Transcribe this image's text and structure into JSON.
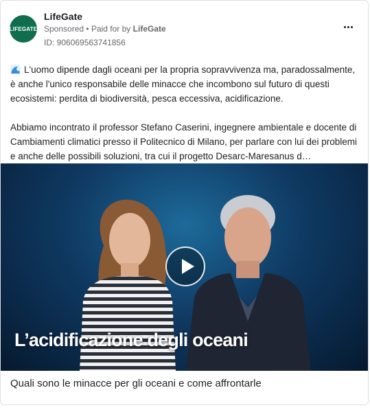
{
  "page": {
    "name": "LifeGate",
    "avatar_text": "LIFEGATE",
    "sponsored_label": "Sponsored",
    "separator": "•",
    "paid_for_by_prefix": "Paid for by",
    "paid_for_by": "LifeGate",
    "ad_id_label": "ID: 906069563741856"
  },
  "post": {
    "paragraph_1": "L'uomo dipende dagli oceani per la propria sopravvivenza ma, paradossalmente, è anche l'unico responsabile delle minacce che incombono sul futuro di questi ecosistemi: perdita di biodiversità, pesca eccessiva, acidificazione.",
    "paragraph_2": "Abbiamo incontrato il professor Stefano Caserini, ingegnere ambientale e docente di Cambiamenti climatici presso il Politecnico di Milano, per parlare con lui dei problemi e anche delle possibili soluzioni, tra cui il progetto Desarc-Maresanus d…",
    "lead_icon": "wave-icon"
  },
  "video": {
    "title_overlay": "L’acidificazione degli oceani",
    "play_icon": "play-icon"
  },
  "caption": "Quali sono le minacce per gli oceani e come affrontarle",
  "colors": {
    "avatar_bg": "#0f6e4e",
    "meta_text": "#65676b",
    "video_bg": "#0f3a63"
  }
}
